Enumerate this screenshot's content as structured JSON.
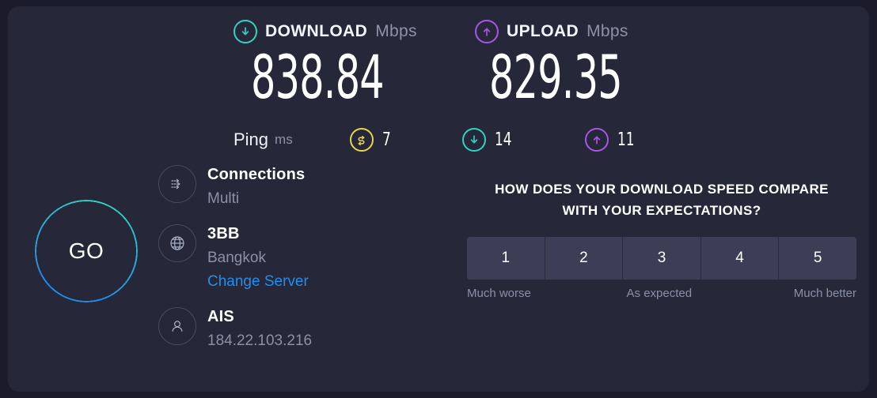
{
  "results": {
    "download": {
      "label": "DOWNLOAD",
      "unit": "Mbps",
      "value": "838.84",
      "icon": "download-arrow-circle-icon",
      "color": "#2ed3c1"
    },
    "upload": {
      "label": "UPLOAD",
      "unit": "Mbps",
      "value": "829.35",
      "icon": "upload-arrow-circle-icon",
      "color": "#a855e8"
    }
  },
  "ping": {
    "label": "Ping",
    "unit": "ms",
    "idle": {
      "value": "7",
      "icon": "idle-latency-icon",
      "color": "#e8d44d"
    },
    "download": {
      "value": "14",
      "icon": "download-arrow-circle-icon",
      "color": "#2ed3c1"
    },
    "upload": {
      "value": "11",
      "icon": "upload-arrow-circle-icon",
      "color": "#a855e8"
    }
  },
  "go_button": {
    "label": "GO",
    "ring_color_top": "#2ed3c1",
    "ring_color_bottom": "#1f8ef1"
  },
  "info": {
    "connections": {
      "title": "Connections",
      "subtitle": "Multi",
      "icon": "multi-connections-icon"
    },
    "server": {
      "title": "3BB",
      "subtitle": "Bangkok",
      "link": "Change Server",
      "link_color": "#1f8ef1",
      "icon": "globe-icon"
    },
    "client": {
      "title": "AIS",
      "subtitle": "184.22.103.216",
      "icon": "person-icon"
    }
  },
  "survey": {
    "question_line1": "HOW DOES YOUR DOWNLOAD SPEED COMPARE",
    "question_line2": "WITH YOUR EXPECTATIONS?",
    "ratings": [
      "1",
      "2",
      "3",
      "4",
      "5"
    ],
    "legend_low": "Much worse",
    "legend_mid": "As expected",
    "legend_high": "Much better"
  }
}
